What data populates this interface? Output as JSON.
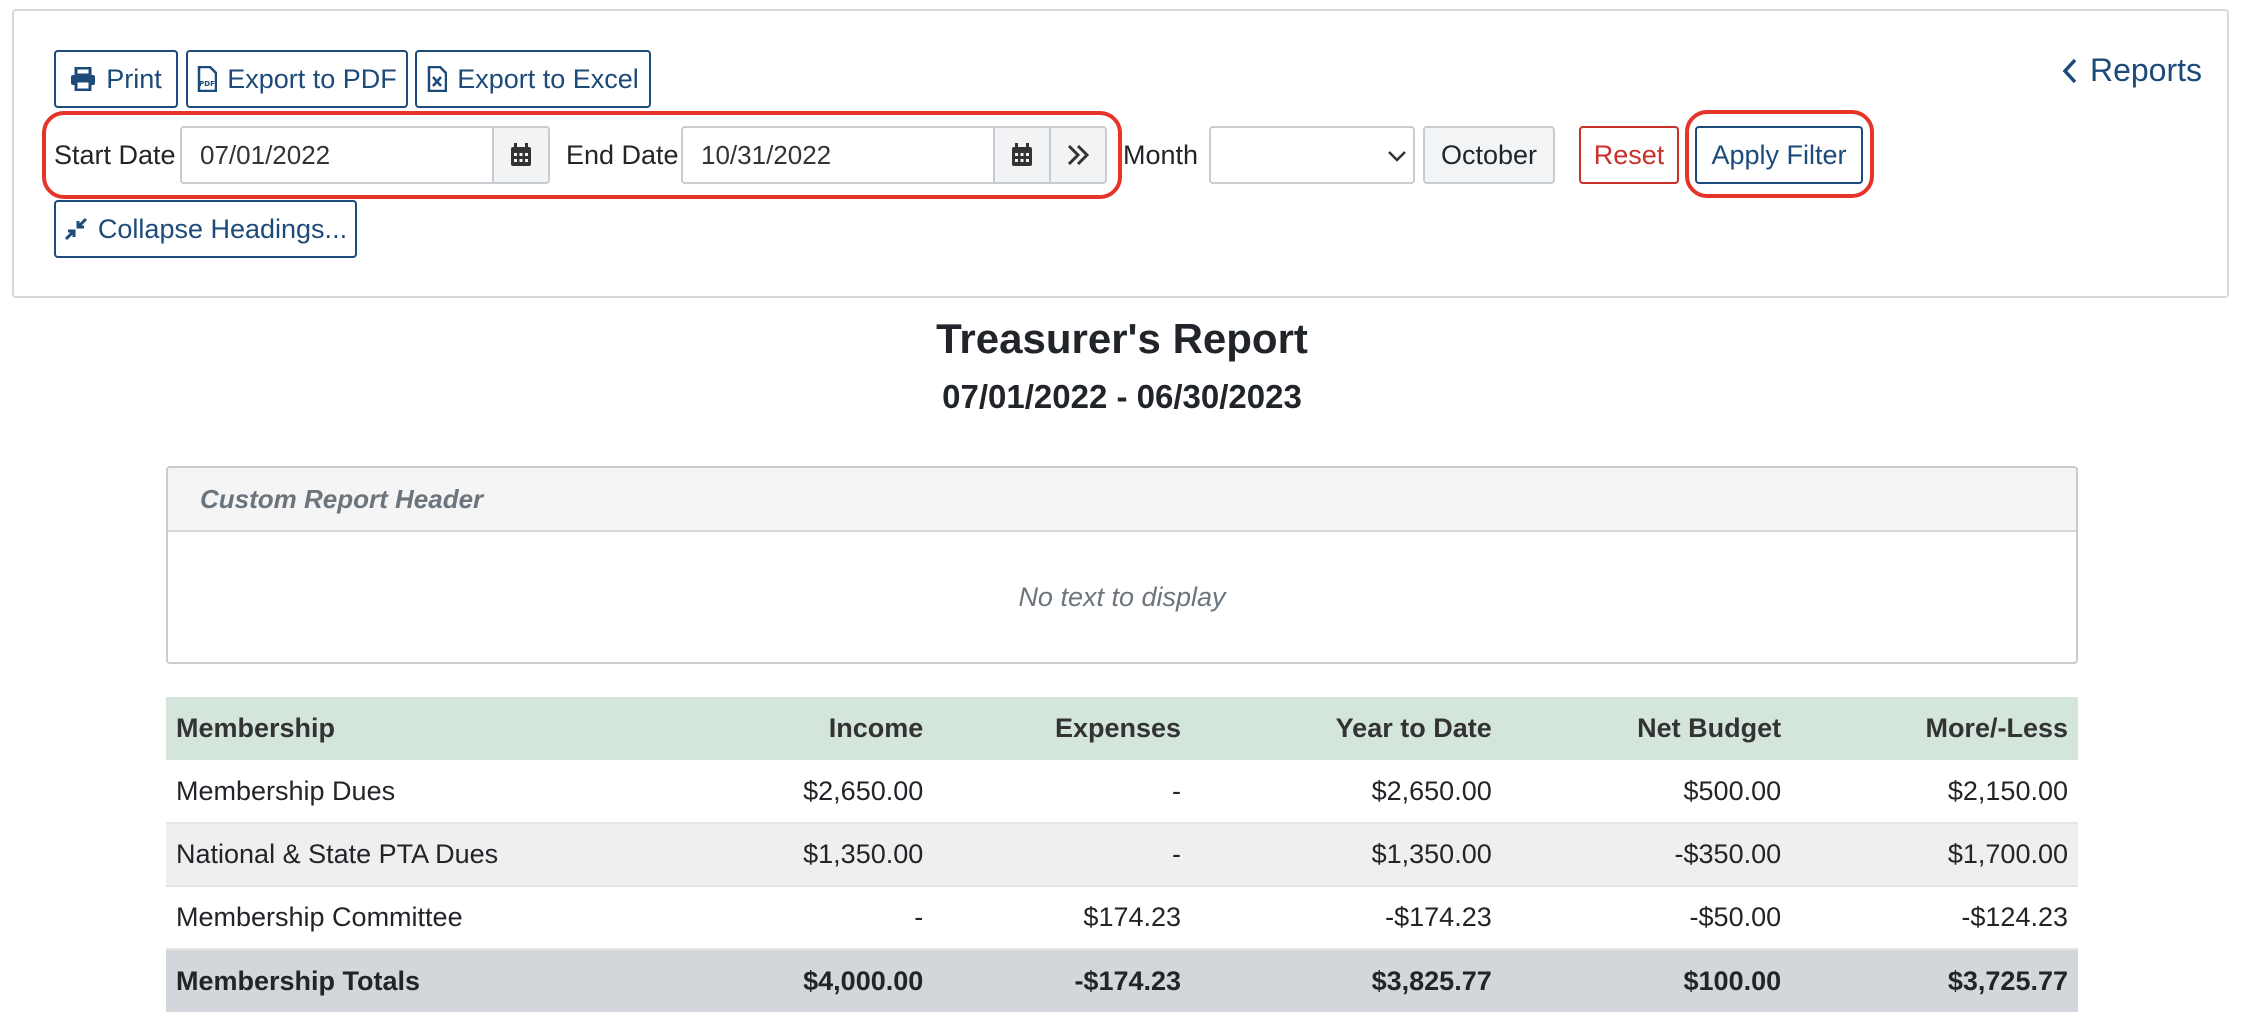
{
  "toolbar": {
    "print_label": "Print",
    "export_pdf_label": "Export to PDF",
    "export_excel_label": "Export to Excel",
    "start_date_label": "Start Date",
    "start_date_value": "07/01/2022",
    "end_date_label": "End Date",
    "end_date_value": "10/31/2022",
    "month_label": "Month",
    "month_value": "",
    "month_button_label": "October",
    "reset_label": "Reset",
    "apply_filter_label": "Apply Filter",
    "collapse_label": "Collapse Headings...",
    "reports_link_label": "Reports"
  },
  "report": {
    "title": "Treasurer's Report",
    "subtitle": "07/01/2022 - 06/30/2023",
    "custom_header_title": "Custom Report Header",
    "custom_header_body": "No text to display"
  },
  "table": {
    "headers": [
      "Membership",
      "Income",
      "Expenses",
      "Year to Date",
      "Net Budget",
      "More/-Less"
    ],
    "rows": [
      [
        "Membership Dues",
        "$2,650.00",
        "-",
        "$2,650.00",
        "$500.00",
        "$2,150.00"
      ],
      [
        "National & State PTA Dues",
        "$1,350.00",
        "-",
        "$1,350.00",
        "-$350.00",
        "$1,700.00"
      ],
      [
        "Membership Committee",
        "-",
        "$174.23",
        "-$174.23",
        "-$50.00",
        "-$124.23"
      ]
    ],
    "totals": [
      "Membership Totals",
      "$4,000.00",
      "-$174.23",
      "$3,825.77",
      "$100.00",
      "$3,725.77"
    ]
  },
  "colors": {
    "primary": "#1c4a7a",
    "danger": "#c8302a",
    "highlight": "#e5352b",
    "table_header": "#d4e6dc",
    "totals_row": "#d3d6da"
  },
  "icons": {
    "print": "printer-icon",
    "pdf": "pdf-file-icon",
    "excel": "excel-file-icon",
    "calendar": "calendar-icon",
    "double_chevron": "double-chevron-right-icon",
    "select_caret": "chevron-down-icon",
    "collapse": "compress-arrows-icon",
    "back": "chevron-left-icon"
  }
}
